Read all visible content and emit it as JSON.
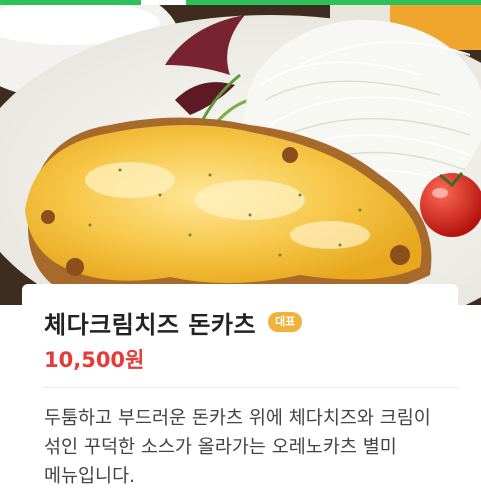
{
  "menu": {
    "title": "체다크림치즈 돈카츠",
    "badge": "대표",
    "price": "10,500원",
    "description": "두툼하고 부드러운 돈카츠 위에 체다치즈와 크림이 섞인 꾸덕한 소스가 올라가는 오레노카츠 별미 메뉴입니다."
  },
  "colors": {
    "accent_green": "#2ec15a",
    "badge": "#f0b23a",
    "price": "#e63b3b"
  }
}
